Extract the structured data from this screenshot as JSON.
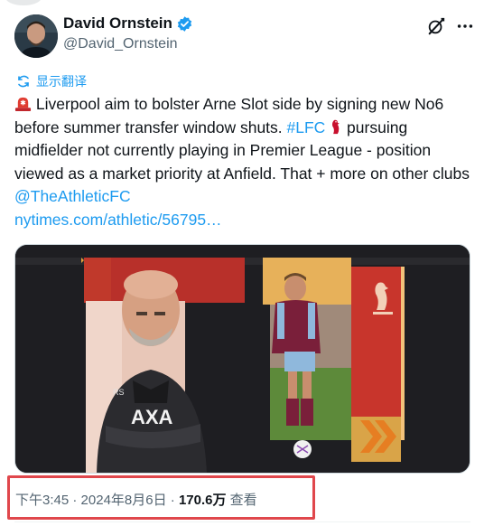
{
  "author": {
    "display_name": "David Ornstein",
    "handle": "@David_Ornstein",
    "verified": true,
    "avatar_icon": "avatar-photo"
  },
  "colors": {
    "link": "#1d9bf0",
    "secondary_text": "#536471",
    "verified_badge": "#1d9bf0",
    "highlight_box": "#e0474c"
  },
  "translate": {
    "label": "显示翻译",
    "icon": "translate-icon"
  },
  "tweet": {
    "text_part1": "Liverpool aim to bolster Arne Slot side by signing new No6 before summer transfer window shuts. ",
    "hashtag": "#LFC",
    "text_part2": " pursuing midfielder not currently playing in Premier League - position viewed as a market priority at Anfield. That + more on other clubs ",
    "mention": "@TheAthleticFC",
    "link": "nytimes.com/athletic/56795…"
  },
  "meta": {
    "time": "下午3:45",
    "date": "2024年8月6日",
    "views": "170.6万",
    "views_label": "查看"
  },
  "actions": {
    "grok_icon": "grok-icon",
    "more_icon": "more-icon"
  }
}
